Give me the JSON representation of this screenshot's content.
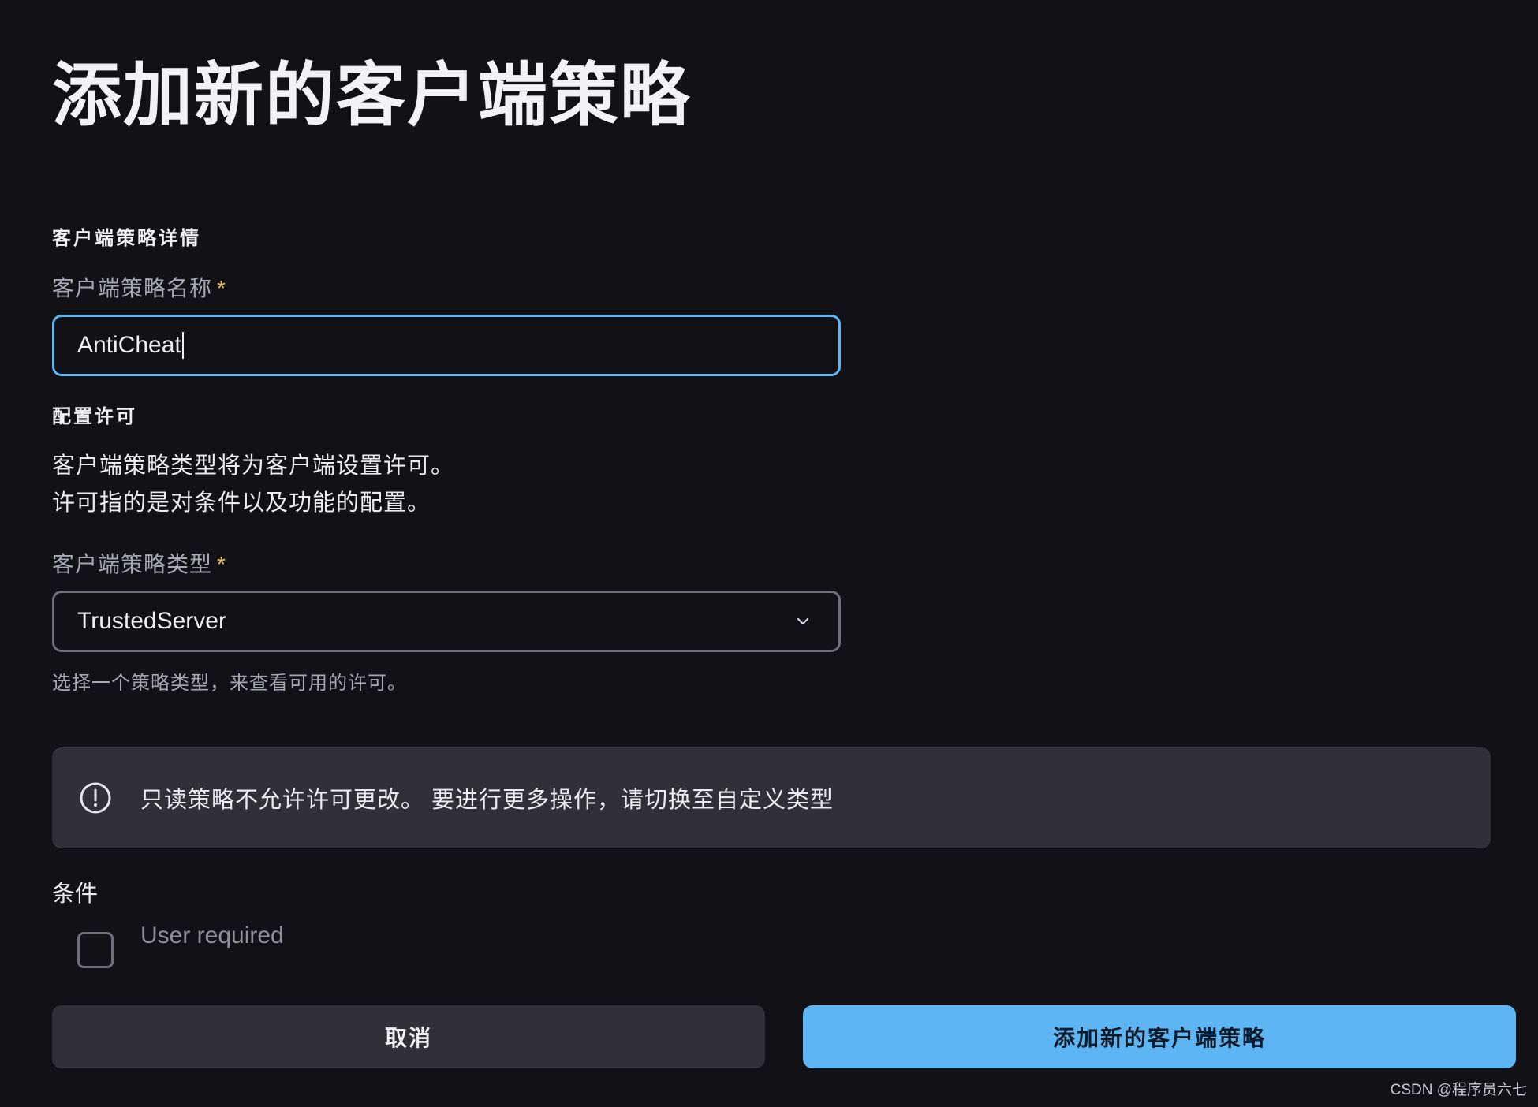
{
  "page": {
    "title": "添加新的客户端策略"
  },
  "details_section": {
    "heading": "客户端策略详情",
    "name_field": {
      "label": "客户端策略名称",
      "required_mark": "*",
      "value": "AntiCheat"
    }
  },
  "permissions_section": {
    "heading": "配置许可",
    "description_lines": [
      "客户端策略类型将为客户端设置许可。",
      "许可指的是对条件以及功能的配置。"
    ],
    "type_field": {
      "label": "客户端策略类型",
      "required_mark": "*",
      "selected": "TrustedServer",
      "helper": "选择一个策略类型，来查看可用的许可。"
    }
  },
  "alert": {
    "icon": "info-circle-icon",
    "text": "只读策略不允许许可更改。 要进行更多操作，请切换至自定义类型"
  },
  "conditions": {
    "heading": "条件",
    "items": [
      {
        "label": "User required",
        "checked": false
      }
    ]
  },
  "footer": {
    "cancel_label": "取消",
    "submit_label": "添加新的客户端策略"
  },
  "watermark": "CSDN @程序员六七",
  "colors": {
    "background": "#111116",
    "accent": "#5db6f3",
    "required": "#e7c25c",
    "panel": "#303036"
  }
}
